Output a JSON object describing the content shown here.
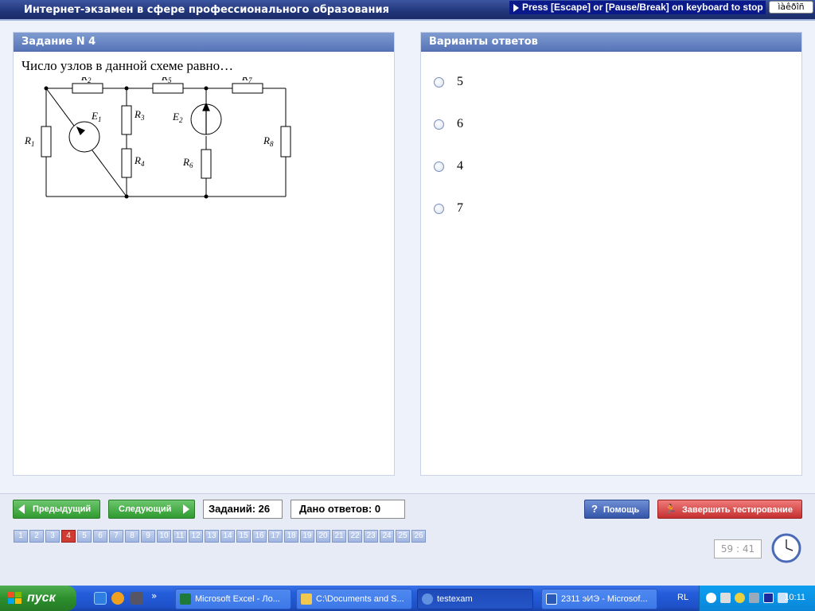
{
  "app": {
    "title": "Интернет-экзамен в сфере профессионального образования",
    "hint": "Press [Escape] or [Pause/Break] on keyboard to stop",
    "kbd_label": "ìàêðîñ"
  },
  "task_panel": {
    "header": "Задание N 4",
    "question": "Число узлов в данной схеме равно…"
  },
  "circuit": {
    "labels": {
      "R1": "R",
      "R1_sub": "1",
      "R2": "R",
      "R2_sub": "2",
      "R3": "R",
      "R3_sub": "3",
      "R4": "R",
      "R4_sub": "4",
      "R5": "R",
      "R5_sub": "5",
      "R6": "R",
      "R6_sub": "6",
      "R7": "R",
      "R7_sub": "7",
      "R8": "R",
      "R8_sub": "8",
      "E1": "E",
      "E1_sub": "1",
      "E2": "E",
      "E2_sub": "2"
    }
  },
  "answers_panel": {
    "header": "Варианты ответов",
    "options": [
      "5",
      "6",
      "4",
      "7"
    ]
  },
  "controls": {
    "prev_label": "Предыдущий",
    "next_label": "Следующий",
    "tasks_count": "Заданий: 26",
    "answers_given": "Дано ответов: 0",
    "help_label": "Помощь",
    "finish_label": "Завершить тестирование"
  },
  "nav": {
    "current": 4,
    "numbers": [
      "1",
      "2",
      "3",
      "4",
      "5",
      "6",
      "7",
      "8",
      "9",
      "10",
      "11",
      "12",
      "13",
      "14",
      "15",
      "16",
      "17",
      "18",
      "19",
      "20",
      "21",
      "22",
      "23",
      "24",
      "25",
      "26"
    ]
  },
  "timer": "59 : 41",
  "taskbar": {
    "start_label": "пуск",
    "more_label": "»",
    "tasks": [
      "Microsoft Excel - Ло...",
      "C:\\Documents and S...",
      "testexam",
      "2311 эИЭ - Microsof..."
    ],
    "active_task": 2,
    "lang": "RL",
    "time": "10:11"
  },
  "colors": {
    "accent": "#21357a",
    "panel_header": "#5675b8",
    "nav_green": "#2f9a2f",
    "finish_red": "#c53030",
    "help_blue": "#3454a8",
    "current_task": "#d03a30"
  }
}
